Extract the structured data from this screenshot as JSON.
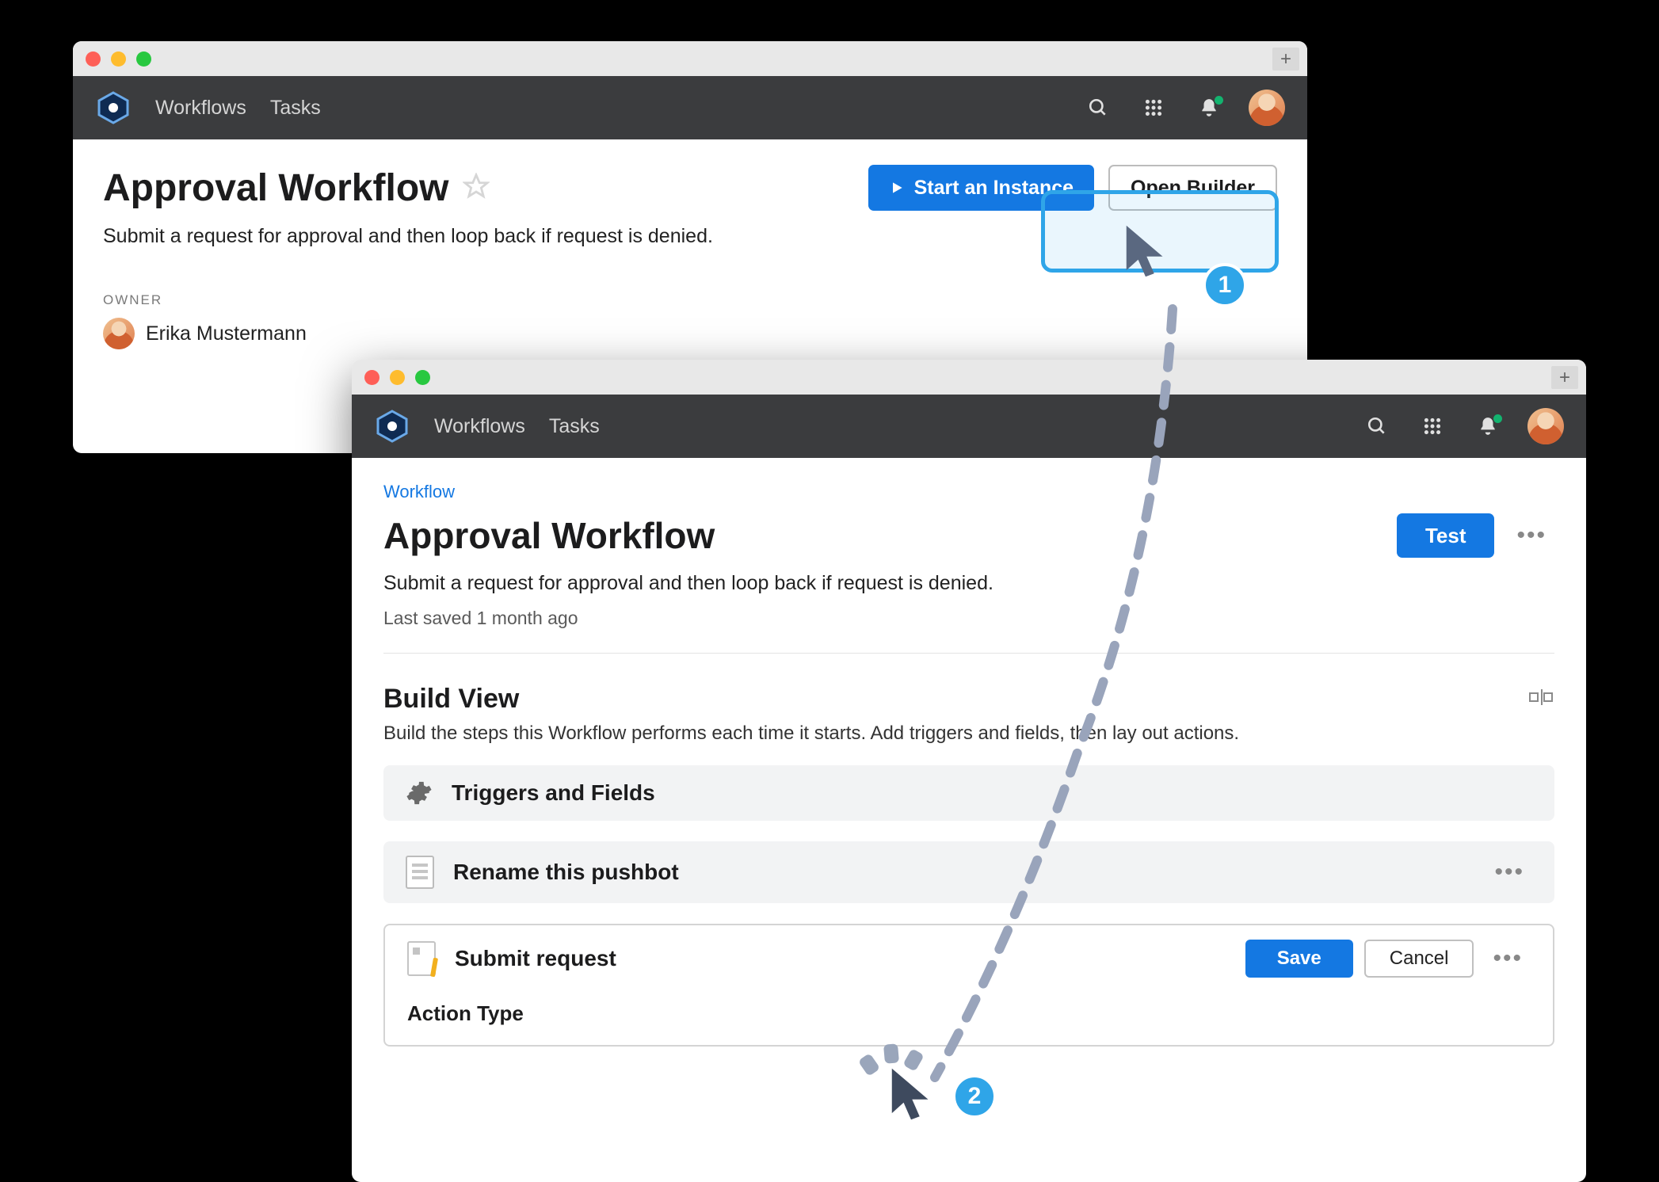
{
  "nav": {
    "workflows": "Workflows",
    "tasks": "Tasks"
  },
  "window1": {
    "title": "Approval Workflow",
    "start_instance": "Start an Instance",
    "open_builder": "Open Builder",
    "description": "Submit a request for approval and then loop back if request is denied.",
    "owner_label": "OWNER",
    "owner_name": "Erika Mustermann"
  },
  "window2": {
    "breadcrumb": "Workflow",
    "title": "Approval Workflow",
    "test": "Test",
    "description": "Submit a request for approval and then loop back if request is denied.",
    "last_saved": "Last saved 1 month ago",
    "build_view_title": "Build View",
    "build_view_sub": "Build the steps this Workflow performs each time it starts. Add triggers and fields, then lay out actions.",
    "triggers_fields": "Triggers and Fields",
    "rename_pushbot": "Rename this pushbot",
    "submit_request": "Submit request",
    "save": "Save",
    "cancel": "Cancel",
    "action_type": "Action Type"
  },
  "steps": {
    "one": "1",
    "two": "2"
  }
}
